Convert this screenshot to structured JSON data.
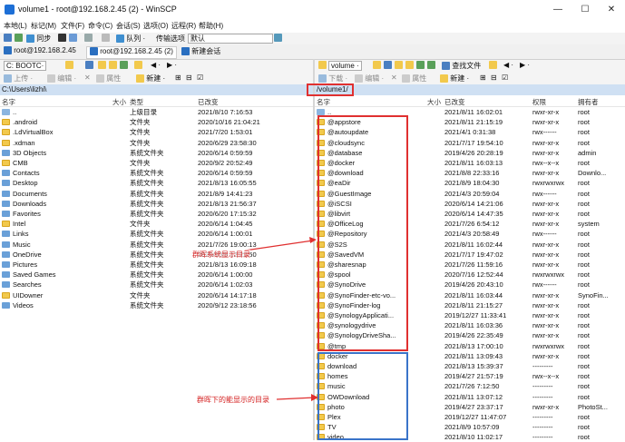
{
  "window": {
    "title": "volume1 - root@192.168.2.45 (2) - WinSCP",
    "minimize": "—",
    "maximize": "☐",
    "close": "✕"
  },
  "menu": [
    "本地(L)",
    "标记(M)",
    "文件(F)",
    "命令(C)",
    "会话(S)",
    "选项(O)",
    "远程(R)",
    "帮助(H)"
  ],
  "toolbar": {
    "sync_label": "同步",
    "queue_label": "队列 ·",
    "transfer_label": "传输选项",
    "transfer_value": "默认"
  },
  "tabs": [
    {
      "label": "root@192.168.2.45"
    },
    {
      "label": "root@192.168.2.45 (2)"
    },
    {
      "label": "新建会话"
    }
  ],
  "left_pane": {
    "drive": "C: BOOTC·",
    "upload": "上传 ·",
    "edit": "编辑 ·",
    "props": "属性",
    "new": "新建 ·",
    "path": "C:\\Users\\lizhi\\",
    "columns": {
      "name": "名字",
      "size": "大小",
      "type": "类型",
      "changed": "已改变"
    },
    "rows": [
      {
        "name": "..",
        "type": "上级目录",
        "changed": "2021/8/10  7:16:53",
        "icon": "up"
      },
      {
        "name": ".android",
        "type": "文件夹",
        "changed": "2020/10/16  21:04:21",
        "icon": "folder"
      },
      {
        "name": ".LdVirtualBox",
        "type": "文件夹",
        "changed": "2021/7/20  1:53:01",
        "icon": "folder"
      },
      {
        "name": ".xdman",
        "type": "文件夹",
        "changed": "2020/6/29  23:58:30",
        "icon": "folder"
      },
      {
        "name": "3D Objects",
        "type": "系统文件夹",
        "changed": "2020/6/14  0:59:59",
        "icon": "sys"
      },
      {
        "name": "CMB",
        "type": "文件夹",
        "changed": "2020/9/2  20:52:49",
        "icon": "folder"
      },
      {
        "name": "Contacts",
        "type": "系统文件夹",
        "changed": "2020/6/14  0:59:59",
        "icon": "sys"
      },
      {
        "name": "Desktop",
        "type": "系统文件夹",
        "changed": "2021/8/13  16:05:55",
        "icon": "sys"
      },
      {
        "name": "Documents",
        "type": "系统文件夹",
        "changed": "2021/8/9  14:41:23",
        "icon": "sys"
      },
      {
        "name": "Downloads",
        "type": "系统文件夹",
        "changed": "2021/8/13  21:56:37",
        "icon": "sys"
      },
      {
        "name": "Favorites",
        "type": "系统文件夹",
        "changed": "2020/6/20  17:15:32",
        "icon": "sys"
      },
      {
        "name": "Intel",
        "type": "文件夹",
        "changed": "2020/6/14  1:04:45",
        "icon": "folder"
      },
      {
        "name": "Links",
        "type": "系统文件夹",
        "changed": "2020/6/14  1:00:01",
        "icon": "sys"
      },
      {
        "name": "Music",
        "type": "系统文件夹",
        "changed": "2021/7/26  19:00:13",
        "icon": "sys"
      },
      {
        "name": "OneDrive",
        "type": "系统文件夹",
        "changed": "2020/10/9  12:22:50",
        "icon": "sys"
      },
      {
        "name": "Pictures",
        "type": "系统文件夹",
        "changed": "2021/8/13  16:09:18",
        "icon": "sys"
      },
      {
        "name": "Saved Games",
        "type": "系统文件夹",
        "changed": "2020/6/14  1:00:00",
        "icon": "sys"
      },
      {
        "name": "Searches",
        "type": "系统文件夹",
        "changed": "2020/6/14  1:02:03",
        "icon": "sys"
      },
      {
        "name": "UIDowner",
        "type": "文件夹",
        "changed": "2020/6/14  14:17:18",
        "icon": "folder"
      },
      {
        "name": "Videos",
        "type": "系统文件夹",
        "changed": "2020/9/12  23:18:56",
        "icon": "sys"
      }
    ]
  },
  "right_pane": {
    "drive": "volume ·",
    "find": "查找文件",
    "download": "下载 ·",
    "edit": "编辑 ·",
    "props": "属性",
    "new": "新建 ·",
    "path": "/volume1/",
    "columns": {
      "name": "名字",
      "size": "大小",
      "changed": "已改变",
      "rights": "权限",
      "owner": "拥有者"
    },
    "rows": [
      {
        "name": "..",
        "changed": "2021/8/11 16:02:01",
        "rights": "rwxr-xr-x",
        "owner": "root",
        "icon": "up"
      },
      {
        "name": "@appstore",
        "changed": "2021/8/11 21:15:19",
        "rights": "rwxr-xr-x",
        "owner": "root",
        "icon": "folder"
      },
      {
        "name": "@autoupdate",
        "changed": "2021/4/1 0:31:38",
        "rights": "rwx------",
        "owner": "root",
        "icon": "folder"
      },
      {
        "name": "@cloudsync",
        "changed": "2021/7/17 19:54:10",
        "rights": "rwxr-xr-x",
        "owner": "root",
        "icon": "folder"
      },
      {
        "name": "@database",
        "changed": "2019/4/26 20:28:19",
        "rights": "rwxr-xr-x",
        "owner": "admin",
        "icon": "folder"
      },
      {
        "name": "@docker",
        "changed": "2021/8/11 16:03:13",
        "rights": "rwx--x--x",
        "owner": "root",
        "icon": "folder"
      },
      {
        "name": "@download",
        "changed": "2021/8/8 22:33:16",
        "rights": "rwxr-xr-x",
        "owner": "Downlo...",
        "icon": "folder"
      },
      {
        "name": "@eaDir",
        "changed": "2021/8/9 18:04:30",
        "rights": "rwxrwxrwx",
        "owner": "root",
        "icon": "folder"
      },
      {
        "name": "@GuestImage",
        "changed": "2021/4/3 20:59:04",
        "rights": "rwx------",
        "owner": "root",
        "icon": "folder"
      },
      {
        "name": "@iSCSI",
        "changed": "2020/6/14 14:21:06",
        "rights": "rwxr-xr-x",
        "owner": "root",
        "icon": "folder"
      },
      {
        "name": "@libvirt",
        "changed": "2020/6/14 14:47:35",
        "rights": "rwxr-xr-x",
        "owner": "root",
        "icon": "folder"
      },
      {
        "name": "@OfficeLog",
        "changed": "2021/7/26 6:54:12",
        "rights": "rwxr-xr-x",
        "owner": "system",
        "icon": "folder"
      },
      {
        "name": "@Repository",
        "changed": "2021/4/3 20:58:49",
        "rights": "rwx------",
        "owner": "root",
        "icon": "folder"
      },
      {
        "name": "@S2S",
        "changed": "2021/8/11 16:02:44",
        "rights": "rwxr-xr-x",
        "owner": "root",
        "icon": "folder"
      },
      {
        "name": "@SavedVM",
        "changed": "2021/7/17 19:47:02",
        "rights": "rwxr-xr-x",
        "owner": "root",
        "icon": "folder"
      },
      {
        "name": "@sharesnap",
        "changed": "2021/7/26 11:59:16",
        "rights": "rwxr-xr-x",
        "owner": "root",
        "icon": "folder"
      },
      {
        "name": "@spool",
        "changed": "2020/7/16 12:52:44",
        "rights": "rwxrwxrwx",
        "owner": "root",
        "icon": "folder"
      },
      {
        "name": "@SynoDrive",
        "changed": "2019/4/26 20:43:10",
        "rights": "rwx------",
        "owner": "root",
        "icon": "folder"
      },
      {
        "name": "@SynoFinder-etc-vo...",
        "changed": "2021/8/11 16:03:44",
        "rights": "rwxr-xr-x",
        "owner": "SynoFin...",
        "icon": "folder"
      },
      {
        "name": "@SynoFinder-log",
        "changed": "2021/8/11 21:15:27",
        "rights": "rwxr-xr-x",
        "owner": "root",
        "icon": "folder"
      },
      {
        "name": "@SynologyApplicati...",
        "changed": "2019/12/27 11:33:41",
        "rights": "rwxr-xr-x",
        "owner": "root",
        "icon": "folder"
      },
      {
        "name": "@synologydrive",
        "changed": "2021/8/11 16:03:36",
        "rights": "rwxr-xr-x",
        "owner": "root",
        "icon": "folder"
      },
      {
        "name": "@SynologyDriveSha...",
        "changed": "2019/4/26 22:35:49",
        "rights": "rwxr-xr-x",
        "owner": "root",
        "icon": "folder"
      },
      {
        "name": "@tmp",
        "changed": "2021/8/13 17:00:10",
        "rights": "rwxrwxrwx",
        "owner": "root",
        "icon": "folder"
      },
      {
        "name": "docker",
        "changed": "2021/8/11 13:09:43",
        "rights": "rwxr-xr-x",
        "owner": "root",
        "icon": "folder"
      },
      {
        "name": "download",
        "changed": "2021/8/13 15:39:37",
        "rights": "---------",
        "owner": "root",
        "icon": "folder"
      },
      {
        "name": "homes",
        "changed": "2019/4/27 21:57:19",
        "rights": "rwx--x--x",
        "owner": "root",
        "icon": "folder"
      },
      {
        "name": "music",
        "changed": "2021/7/26 7:12:50",
        "rights": "---------",
        "owner": "root",
        "icon": "folder"
      },
      {
        "name": "OWDownload",
        "changed": "2021/8/11 13:07:12",
        "rights": "---------",
        "owner": "root",
        "icon": "folder"
      },
      {
        "name": "photo",
        "changed": "2019/4/27 23:37:17",
        "rights": "rwxr-xr-x",
        "owner": "PhotoSt...",
        "icon": "folder"
      },
      {
        "name": "Plex",
        "changed": "2019/12/27 11:47:07",
        "rights": "---------",
        "owner": "root",
        "icon": "folder"
      },
      {
        "name": "TV",
        "changed": "2021/8/9 10:57:09",
        "rights": "---------",
        "owner": "root",
        "icon": "folder"
      },
      {
        "name": "video",
        "changed": "2021/8/10 11:02:17",
        "rights": "---------",
        "owner": "root",
        "icon": "folder"
      }
    ]
  },
  "annotations": {
    "red_label": "群晖系统显示目录",
    "blue_label": "群晖下的能显示的目录"
  },
  "colors": {
    "accent": "#1d6fd6",
    "path_bg": "#cfe0f3",
    "red": "#e03030",
    "blue": "#3a74c9",
    "folder": "#f2c94c"
  }
}
